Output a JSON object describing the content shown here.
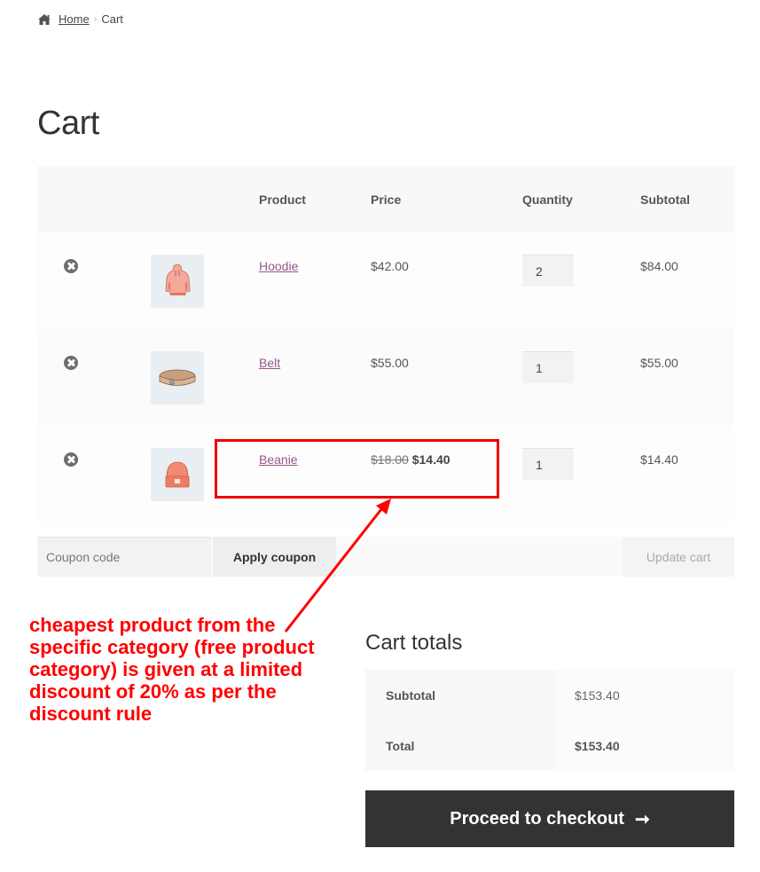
{
  "breadcrumb": {
    "home_icon": "home-icon",
    "home_label": "Home",
    "separator": "›",
    "current": "Cart"
  },
  "page_title": "Cart",
  "cart_table": {
    "headers": {
      "remove": "",
      "thumbnail": "",
      "product": "Product",
      "price": "Price",
      "quantity": "Quantity",
      "subtotal": "Subtotal"
    },
    "items": [
      {
        "name": "Hoodie",
        "image_icon": "hoodie-thumbnail",
        "price_old": "",
        "price": "$42.00",
        "quantity": "2",
        "subtotal": "$84.00"
      },
      {
        "name": "Belt",
        "image_icon": "belt-thumbnail",
        "price_old": "",
        "price": "$55.00",
        "quantity": "1",
        "subtotal": "$55.00"
      },
      {
        "name": "Beanie",
        "image_icon": "beanie-thumbnail",
        "price_old": "$18.00",
        "price": "$14.40",
        "quantity": "1",
        "subtotal": "$14.40"
      }
    ]
  },
  "coupon": {
    "placeholder": "Coupon code",
    "value": "",
    "apply_label": "Apply coupon",
    "update_label": "Update cart"
  },
  "annotation": {
    "text": "cheapest product from the specific category (free product category) is given at a limited discount of 20% as per the discount rule",
    "color": "#ff0000"
  },
  "totals": {
    "title": "Cart totals",
    "rows": [
      {
        "label": "Subtotal",
        "value": "$153.40"
      },
      {
        "label": "Total",
        "value": "$153.40"
      }
    ]
  },
  "checkout": {
    "label": "Proceed to checkout",
    "arrow": "➞"
  },
  "colors": {
    "link": "#96588a",
    "checkout_bg": "#333333",
    "annotation": "#ff0000"
  }
}
